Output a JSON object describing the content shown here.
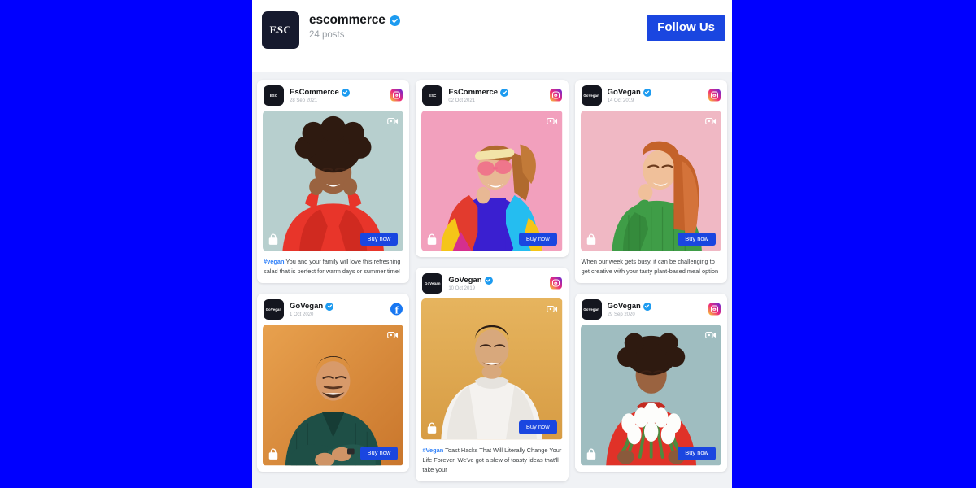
{
  "theme": {
    "page_background": "#0000FF",
    "accent_blue": "#1A46E0",
    "verified_blue": "#1D9BF0",
    "feed_background": "#F0F2F5"
  },
  "profile": {
    "avatar_text": "ESC",
    "name": "escommerce",
    "verified": true,
    "posts": "24 posts",
    "follow_label": "Follow Us"
  },
  "posts": [
    {
      "column": 1,
      "avatar_text": "ESC",
      "name": "EsCommerce",
      "verified": true,
      "date": "28 Sep 2021",
      "network": "instagram",
      "has_video": true,
      "buy_label": "Buy now",
      "art": "red-sweater-woman",
      "caption_tag": "#vegan",
      "caption": " You and your family will love this refreshing salad that is perfect for warm days or summer time!"
    },
    {
      "column": 1,
      "avatar_text": "GoVegan",
      "name": "GoVegan",
      "verified": true,
      "date": "1 Oct 2020",
      "network": "facebook",
      "has_video": true,
      "buy_label": "Buy now",
      "art": "green-shirt-man",
      "caption_tag": "",
      "caption": ""
    },
    {
      "column": 2,
      "avatar_text": "ESC",
      "name": "EsCommerce",
      "verified": true,
      "date": "02 Oct 2021",
      "network": "instagram",
      "has_video": true,
      "buy_label": "Buy now",
      "art": "colorful-jacket-woman",
      "caption_tag": "",
      "caption": ""
    },
    {
      "column": 2,
      "avatar_text": "GoVegan",
      "name": "GoVegan",
      "verified": true,
      "date": "10 Oct 2019",
      "network": "instagram",
      "has_video": true,
      "buy_label": "Buy now",
      "art": "white-sweater-man",
      "caption_tag": "#Vegan",
      "caption": " Toast Hacks That Will Literally Change Your Life Forever. We've got a slew of toasty ideas that'll take your"
    },
    {
      "column": 3,
      "avatar_text": "GoVegan",
      "name": "GoVegan",
      "verified": true,
      "date": "14 Oct 2019",
      "network": "instagram",
      "has_video": true,
      "buy_label": "Buy now",
      "art": "green-knit-woman",
      "caption_tag": "",
      "caption": "When our week gets busy, it can be challenging to get creative with your tasty plant-based meal option"
    },
    {
      "column": 3,
      "avatar_text": "GoVegan",
      "name": "GoVegan",
      "verified": true,
      "date": "29 Sep 2020",
      "network": "instagram",
      "has_video": true,
      "buy_label": "Buy now",
      "art": "tulips-woman",
      "caption_tag": "",
      "caption": ""
    }
  ]
}
